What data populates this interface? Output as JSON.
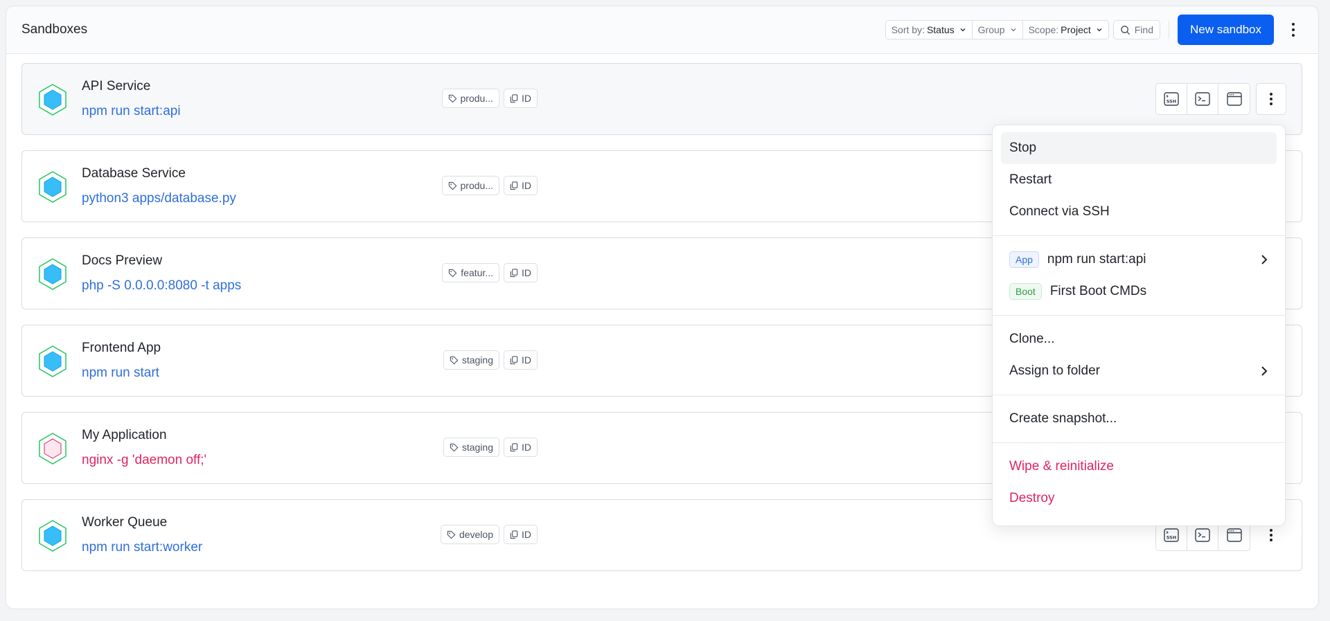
{
  "header": {
    "title": "Sandboxes",
    "sort_label": "Sort by:",
    "sort_value": "Status",
    "group_label": "Group",
    "scope_label": "Scope:",
    "scope_value": "Project",
    "find_label": "Find",
    "new_button": "New sandbox"
  },
  "sandboxes": [
    {
      "name": "API Service",
      "command": "npm run start:api",
      "tag": "produ...",
      "id_label": "ID",
      "status": "running"
    },
    {
      "name": "Database Service",
      "command": "python3 apps/database.py",
      "tag": "produ...",
      "id_label": "ID",
      "status": "running"
    },
    {
      "name": "Docs Preview",
      "command": "php -S 0.0.0.0:8080 -t apps",
      "tag": "featur...",
      "id_label": "ID",
      "status": "running"
    },
    {
      "name": "Frontend App",
      "command": "npm run start",
      "tag": "staging",
      "id_label": "ID",
      "status": "running"
    },
    {
      "name": "My Application",
      "command": "nginx -g 'daemon off;'",
      "tag": "staging",
      "id_label": "ID",
      "status": "error"
    },
    {
      "name": "Worker Queue",
      "command": "npm run start:worker",
      "tag": "develop",
      "id_label": "ID",
      "status": "running"
    }
  ],
  "menu": {
    "stop": "Stop",
    "restart": "Restart",
    "ssh": "Connect via SSH",
    "app_badge": "App",
    "app_cmd": "npm run start:api",
    "boot_badge": "Boot",
    "boot_cmd": "First Boot CMDs",
    "clone": "Clone...",
    "assign": "Assign to folder",
    "snapshot": "Create snapshot...",
    "wipe": "Wipe & reinitialize",
    "destroy": "Destroy"
  },
  "icons": {
    "ssh": "ssh-icon",
    "terminal": "terminal-icon",
    "browser": "browser-window-icon",
    "tag": "tag-icon",
    "copy": "copy-icon",
    "search": "search-icon",
    "chevron": "chevron-down-icon",
    "kebab": "more-vertical-icon"
  },
  "colors": {
    "accent": "#0a5ef0",
    "link": "#2f6fdc",
    "danger": "#e0245e",
    "running": "#22c55e"
  }
}
